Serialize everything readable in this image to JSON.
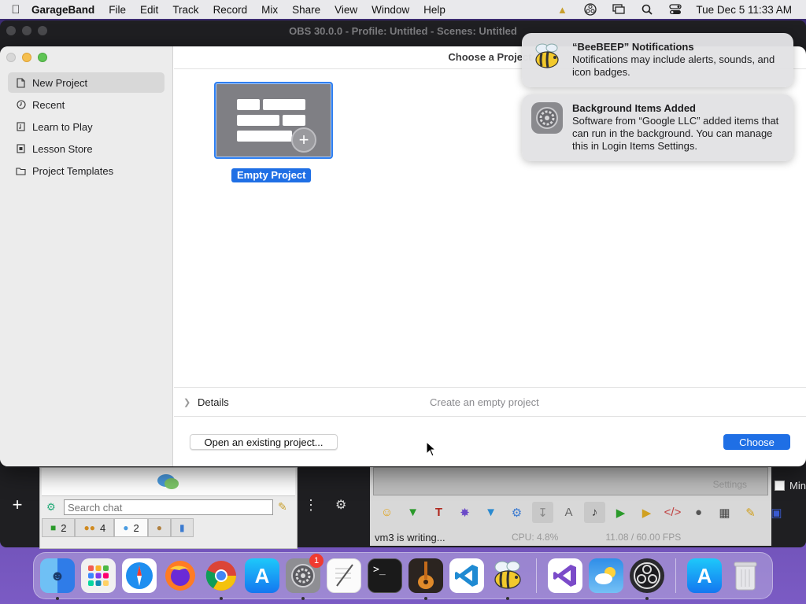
{
  "menubar": {
    "app_name": "GarageBand",
    "menus": [
      "File",
      "Edit",
      "Track",
      "Record",
      "Mix",
      "Share",
      "View",
      "Window",
      "Help"
    ],
    "clock": "Tue Dec 5  11:33 AM"
  },
  "obs": {
    "title": "OBS 30.0.0 - Profile: Untitled - Scenes: Untitled",
    "settings_label": "Settings",
    "min_label": "Min",
    "stats": [
      "CPU: 4.8%",
      "11.08 / 60.00 FPS"
    ]
  },
  "beebeep": {
    "search_placeholder": "Search chat",
    "tabs": [
      {
        "icon": "users-icon",
        "count": "2"
      },
      {
        "icon": "group-icon",
        "count": "4"
      },
      {
        "icon": "chat-icon",
        "count": "2"
      },
      {
        "icon": "people-icon",
        "count": ""
      },
      {
        "icon": "monitor-icon",
        "count": ""
      }
    ],
    "status": "vm3 is writing..."
  },
  "dialog": {
    "title": "Choose a Project",
    "sidebar": [
      {
        "label": "New Project",
        "icon": "document-icon",
        "selected": true
      },
      {
        "label": "Recent",
        "icon": "clock-icon",
        "selected": false
      },
      {
        "label": "Learn to Play",
        "icon": "music-book-icon",
        "selected": false
      },
      {
        "label": "Lesson Store",
        "icon": "store-icon",
        "selected": false
      },
      {
        "label": "Project Templates",
        "icon": "folder-icon",
        "selected": false
      }
    ],
    "project_label": "Empty Project",
    "details_label": "Details",
    "details_desc": "Create an empty project",
    "open_label": "Open an existing project...",
    "choose_label": "Choose"
  },
  "notifications": [
    {
      "title": "“BeeBEEP” Notifications",
      "body": "Notifications may include alerts, sounds, and icon badges.",
      "icon": "bee-icon"
    },
    {
      "title": "Background Items Added",
      "body": "Software from “Google LLC” added items that can run in the background. You can manage this in Login Items Settings.",
      "icon": "system-settings-icon"
    }
  ],
  "dock": {
    "apps": [
      "finder",
      "launchpad",
      "safari",
      "firefox",
      "chrome",
      "app-store",
      "system-settings",
      "textedit",
      "terminal",
      "garageband",
      "vscode",
      "beebeep",
      "visual-studio",
      "weather",
      "obs",
      "app-store-2",
      "trash"
    ],
    "settings_badge": "1"
  },
  "colors": {
    "accent": "#1f6fe5",
    "selection": "#d8d8d8"
  }
}
